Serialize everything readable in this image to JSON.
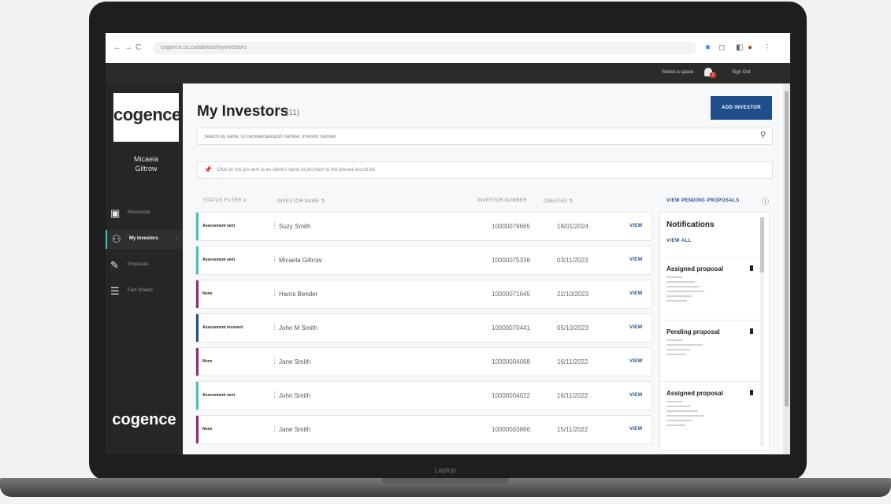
{
  "browser": {
    "url": "cogence.co.za/advisor/myinvestors",
    "back": "←",
    "forward": "→",
    "reload": "C"
  },
  "topbar": {
    "switch_label": "Switch a space",
    "notif_count": "2",
    "signout": "Sign Out"
  },
  "sidebar": {
    "logo": "cogence",
    "user_line1": "Micaela",
    "user_line2": "Giltrow",
    "items": [
      {
        "label": "Resources",
        "icon": "resources-icon"
      },
      {
        "label": "My Investors",
        "icon": "investors-icon"
      },
      {
        "label": "Proposals",
        "icon": "pen-icon"
      },
      {
        "label": "Fact Sheets",
        "icon": "factsheet-icon"
      }
    ],
    "bottom_logo": "cogence"
  },
  "main": {
    "title": "My Investors",
    "count": "(11)",
    "add_button": "ADD INVESTOR",
    "search_placeholder": "Search by name, ID number/passport number, investor number",
    "info_text": "Click on the pin next to an client's name to pin them to the pinned record list"
  },
  "table": {
    "headers": {
      "status": "STATUS FILTER",
      "name": "INVESTOR NAME",
      "number": "INVESTOR NUMBER",
      "created": "CREATED"
    },
    "view_label": "VIEW",
    "rows": [
      {
        "status": "Assessment sent",
        "name": "Suzy Smith",
        "number": "10000079665",
        "created": "18/01/2024",
        "color": "#39c7b5"
      },
      {
        "status": "Assessment sent",
        "name": "Micaela Giltrow",
        "number": "10000075336",
        "created": "03/11/2023",
        "color": "#39c7b5"
      },
      {
        "status": "None",
        "name": "Harris Bender",
        "number": "10000071645",
        "created": "22/10/2023",
        "color": "#8e2a7a"
      },
      {
        "status": "Assessment received",
        "name": "John M Smith",
        "number": "10000070441",
        "created": "05/10/2023",
        "color": "#1f4e8c"
      },
      {
        "status": "None",
        "name": "Jane Smith",
        "number": "10000004068",
        "created": "16/11/2022",
        "color": "#8e2a7a"
      },
      {
        "status": "Assessment sent",
        "name": "John Smith",
        "number": "10000004022",
        "created": "16/11/2022",
        "color": "#39c7b5"
      },
      {
        "status": "None",
        "name": "Jane Smith",
        "number": "10000003866",
        "created": "15/11/2022",
        "color": "#8e2a7a"
      }
    ]
  },
  "pending_link": "VIEW PENDING PROPOSALS",
  "notifications": {
    "title": "Notifications",
    "view_all": "VIEW ALL",
    "items": [
      {
        "title": "Assigned proposal"
      },
      {
        "title": "Pending proposal"
      },
      {
        "title": "Assigned proposal"
      }
    ]
  },
  "laptop_label": "Laptop"
}
